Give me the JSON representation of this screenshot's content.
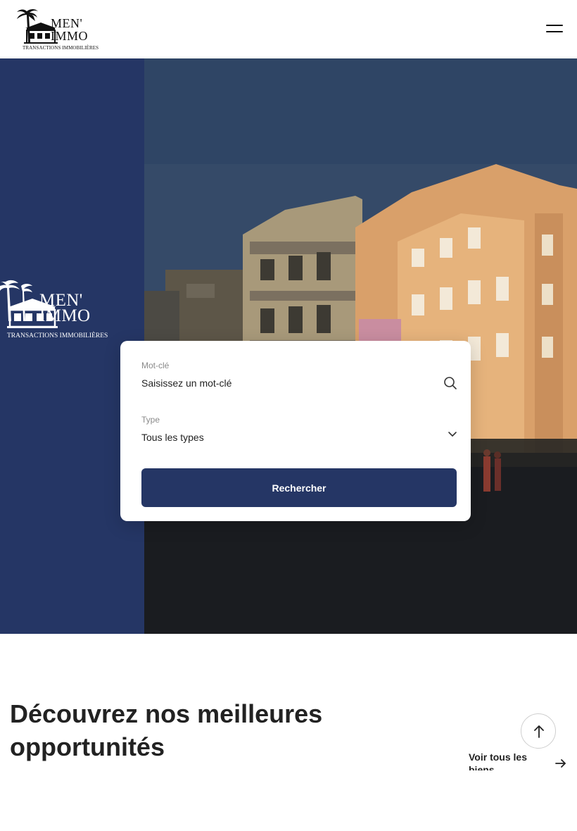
{
  "header": {
    "logo_main": "MEN'\nIMMO",
    "logo_sub": "TRANSACTIONS IMMOBILIÈRES"
  },
  "hero": {
    "logo_main": "MEN'\nIMMO",
    "logo_sub": "TRANSACTIONS IMMOBILIÈRES"
  },
  "search": {
    "keyword_label": "Mot-clé",
    "keyword_placeholder": "Saisissez un mot-clé",
    "type_label": "Type",
    "type_value": "Tous les types",
    "submit_label": "Rechercher"
  },
  "section": {
    "title": "Découvrez nos meilleures opportunités",
    "see_all_label": "Voir tous les biens"
  },
  "colors": {
    "brand_navy": "#253665",
    "text_dark": "#222222"
  },
  "icons": [
    "menu-icon",
    "search-icon",
    "chevron-down-icon",
    "arrow-up-icon",
    "arrow-right-icon"
  ]
}
